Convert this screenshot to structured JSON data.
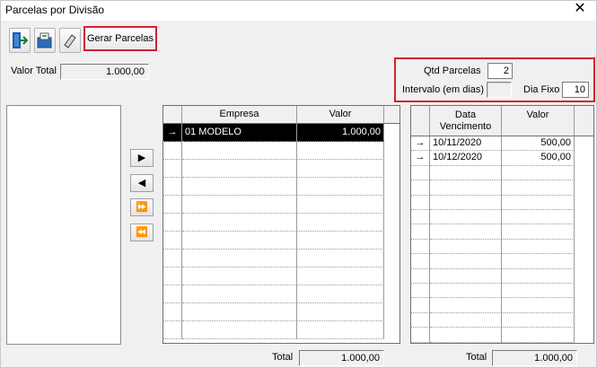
{
  "window": {
    "title": "Parcelas por Divisão",
    "close_label": "✕"
  },
  "toolbar": {
    "exit_icon": "exit-door-icon",
    "open_icon": "folder-open-icon",
    "eraser_icon": "eraser-icon",
    "gerar_label": "Gerar Parcelas"
  },
  "valor_total": {
    "label": "Valor Total",
    "value": "1.000,00"
  },
  "params": {
    "qtd_label": "Qtd Parcelas",
    "qtd_value": "2",
    "intervalo_label": "Intervalo (em dias)",
    "intervalo_value": "",
    "dia_fixo_label": "Dia Fixo",
    "dia_fixo_value": "10"
  },
  "move_buttons": {
    "right": "▶",
    "left": "◀",
    "all_right": "⏩",
    "all_left": "⏪"
  },
  "empresa_grid": {
    "columns": [
      "Empresa",
      "Valor"
    ],
    "rows": [
      {
        "indicator": "→",
        "empresa": "01 MODELO",
        "valor": "1.000,00"
      }
    ],
    "total_label": "Total",
    "total_value": "1.000,00"
  },
  "parcelas_grid": {
    "columns": [
      "Data Vencimento",
      "Valor"
    ],
    "column_line1": "Data",
    "column_line2": "Vencimento",
    "rows": [
      {
        "indicator": "→",
        "data": "10/11/2020",
        "valor": "500,00"
      },
      {
        "indicator": "→",
        "data": "10/12/2020",
        "valor": "500,00"
      }
    ],
    "total_label": "Total",
    "total_value": "1.000,00"
  },
  "colors": {
    "highlight_border": "#d32030",
    "selected_row": "#000000"
  }
}
